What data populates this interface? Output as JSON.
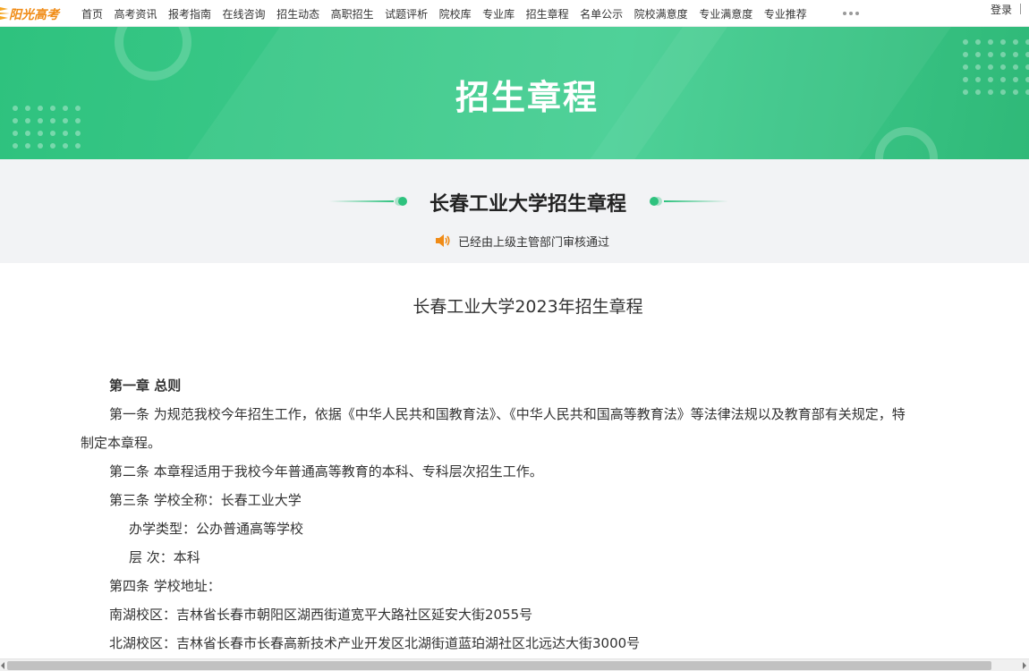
{
  "header": {
    "logo_text": "阳光高考",
    "nav": [
      "首页",
      "高考资讯",
      "报考指南",
      "在线咨询",
      "招生动态",
      "高职招生",
      "试题评析",
      "院校库",
      "专业库",
      "招生章程",
      "名单公示",
      "院校满意度",
      "专业满意度",
      "专业推荐"
    ],
    "login": "登录"
  },
  "banner": {
    "title": "招生章程"
  },
  "subhead": {
    "school_title": "长春工业大学招生章程",
    "audit_text": "已经由上级主管部门审核通过"
  },
  "document": {
    "title": "长春工业大学2023年招生章程",
    "chapter1": "第一章 总则",
    "art1_line1": "第一条 为规范我校今年招生工作，依据《中华人民共和国教育法》、《中华人民共和国高等教育法》等法律法规以及教育部有关规定，特",
    "art1_line2": "制定本章程。",
    "art2": "第二条 本章程适用于我校今年普通高等教育的本科、专科层次招生工作。",
    "art3": "第三条 学校全称：长春工业大学",
    "art3_type": "办学类型：公办普通高等学校",
    "art3_level": "层 次：本科",
    "art4": "第四条 学校地址：",
    "campus_south": "南湖校区：吉林省长春市朝阳区湖西街道宽平大路社区延安大街2055号",
    "campus_north": "北湖校区：吉林省长春市长春高新技术产业开发区北湖街道蓝珀湖社区北远达大街3000号"
  },
  "colors": {
    "brand_green": "#2ec27e",
    "logo_orange": "#f08b16"
  },
  "icons": {
    "audit": "speaker-icon",
    "more": "more-dots-icon"
  }
}
